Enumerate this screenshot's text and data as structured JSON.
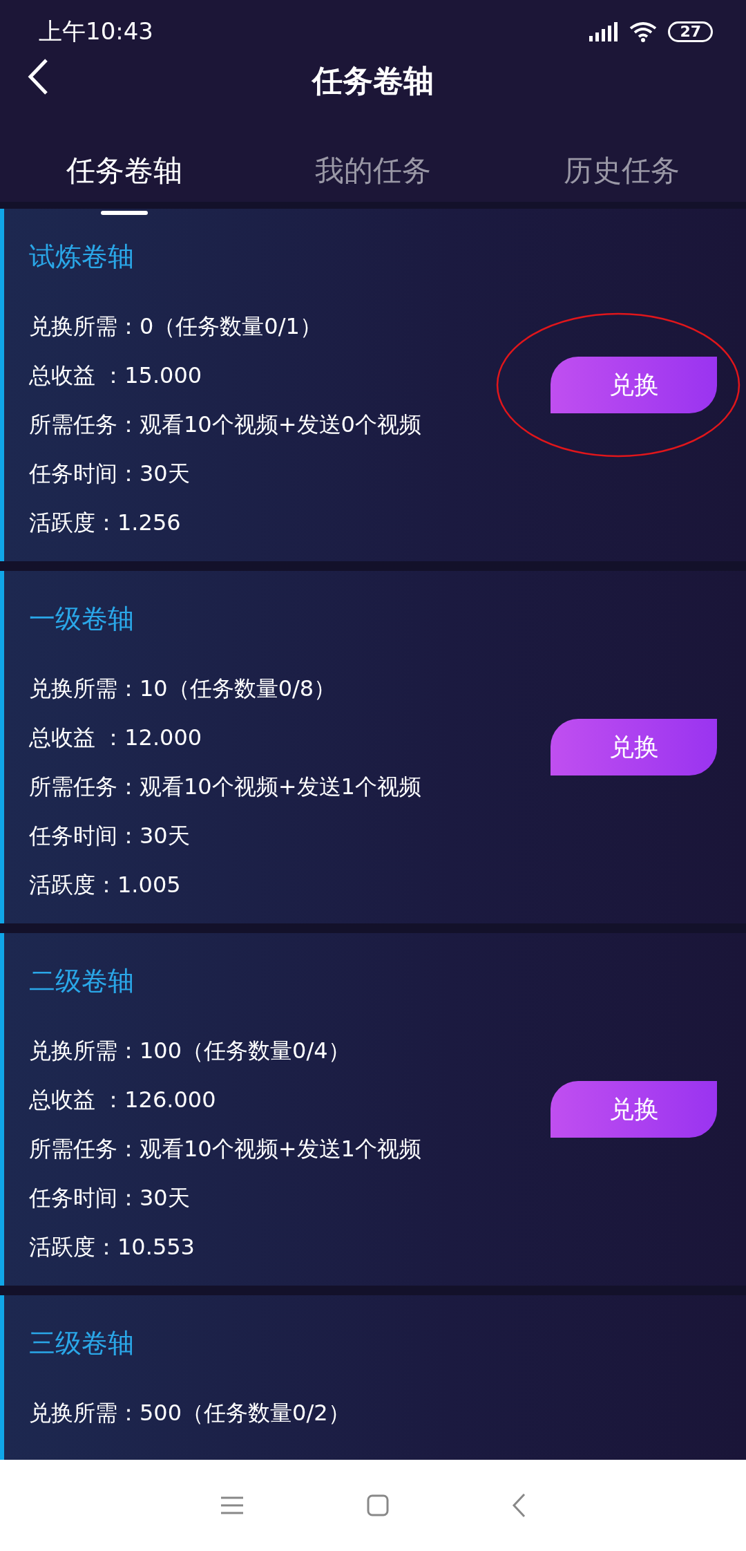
{
  "status_bar": {
    "time": "上午10:43",
    "battery": "27"
  },
  "header": {
    "title": "任务卷轴"
  },
  "tabs": [
    {
      "label": "任务卷轴",
      "selected": true
    },
    {
      "label": "我的任务",
      "selected": false
    },
    {
      "label": "历史任务",
      "selected": false
    }
  ],
  "scrolls": [
    {
      "title": "试炼卷轴",
      "lines": [
        "兑换所需：0（任务数量0/1）",
        "总收益 ：15.000",
        "所需任务：观看10个视频+发送0个视频",
        "任务时间：30天",
        "活跃度：1.256"
      ],
      "button": "兑换",
      "circled": true
    },
    {
      "title": "一级卷轴",
      "lines": [
        "兑换所需：10（任务数量0/8）",
        "总收益 ：12.000",
        "所需任务：观看10个视频+发送1个视频",
        "任务时间：30天",
        "活跃度：1.005"
      ],
      "button": "兑换",
      "circled": false
    },
    {
      "title": "二级卷轴",
      "lines": [
        "兑换所需：100（任务数量0/4）",
        "总收益 ：126.000",
        "所需任务：观看10个视频+发送1个视频",
        "任务时间：30天",
        "活跃度：10.553"
      ],
      "button": "兑换",
      "circled": false
    },
    {
      "title": "三级卷轴",
      "lines": [
        "兑换所需：500（任务数量0/2）"
      ],
      "circled": false
    }
  ]
}
